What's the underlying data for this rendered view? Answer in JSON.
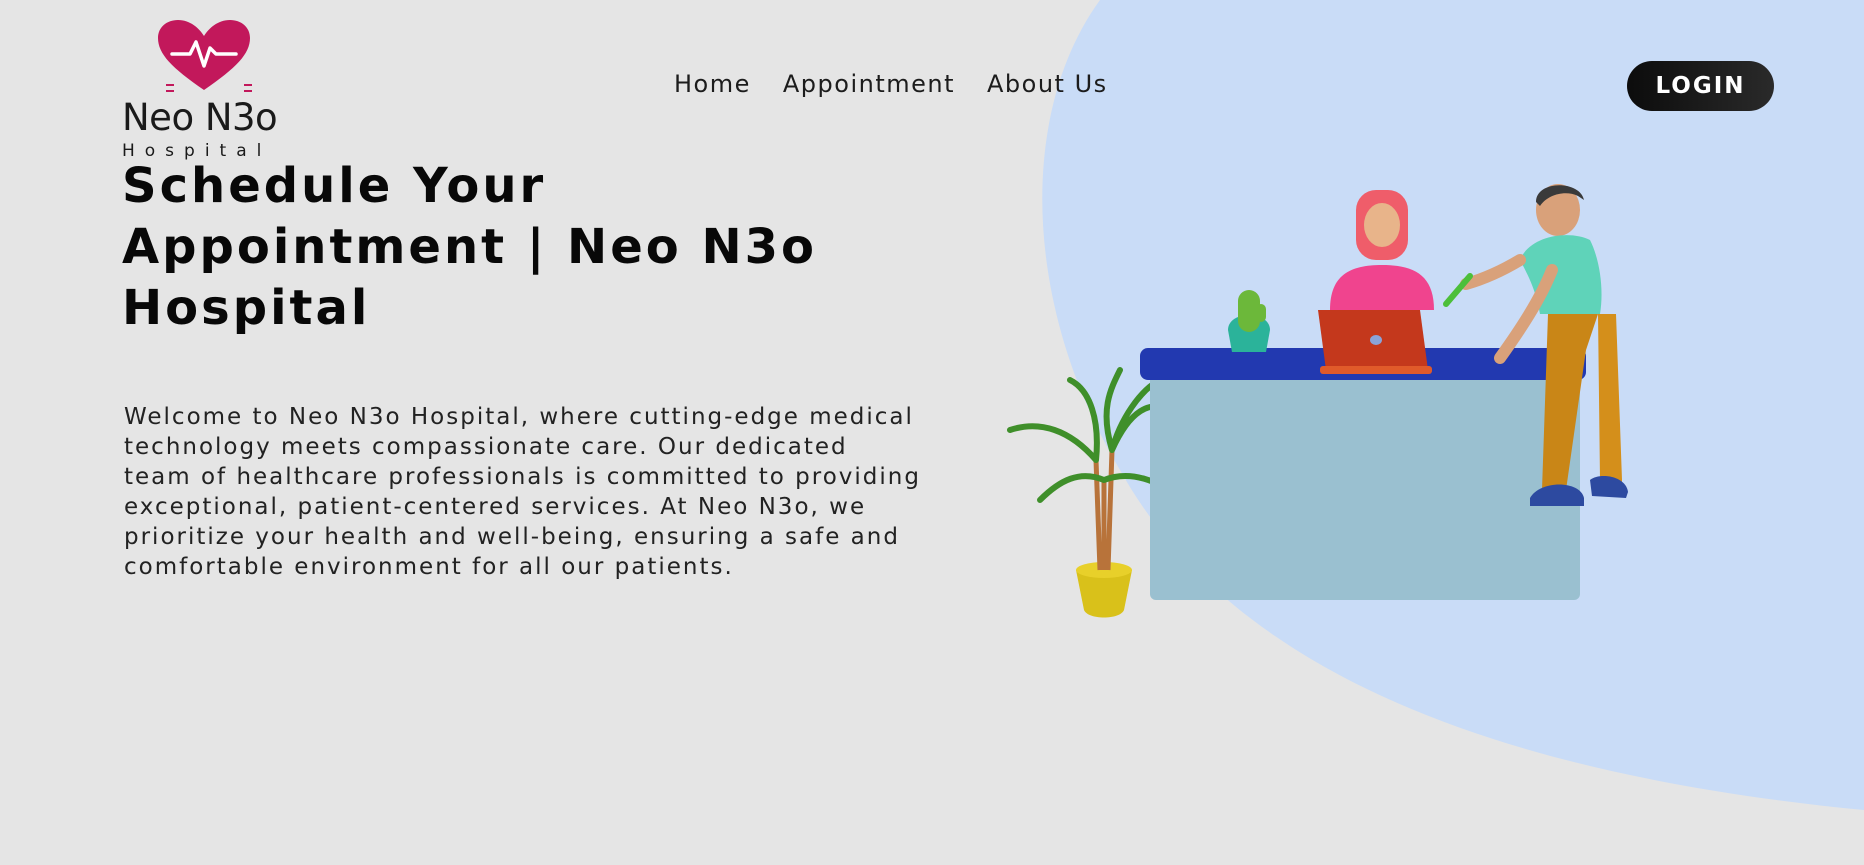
{
  "brand": {
    "name": "Neo N3o",
    "subtitle": "Hospital",
    "colors": {
      "heart": "#c2185b",
      "background": "#e5e5e5",
      "blob": "#c9dcf7",
      "button": "#111111"
    }
  },
  "nav": {
    "items": [
      {
        "label": "Home"
      },
      {
        "label": "Appointment"
      },
      {
        "label": "About Us"
      }
    ]
  },
  "header": {
    "login_label": "LOGIN"
  },
  "hero": {
    "title": "Schedule Your Appointment | Neo N3o Hospital",
    "description": "Welcome to Neo N3o Hospital, where cutting-edge medical technology meets compassionate care. Our dedicated team of healthcare professionals is committed to providing exceptional, patient-centered services. At Neo N3o, we prioritize your health and well-being, ensuring a safe and comfortable environment for all our patients."
  },
  "illustration": {
    "icon": "reception-desk-illustration"
  }
}
